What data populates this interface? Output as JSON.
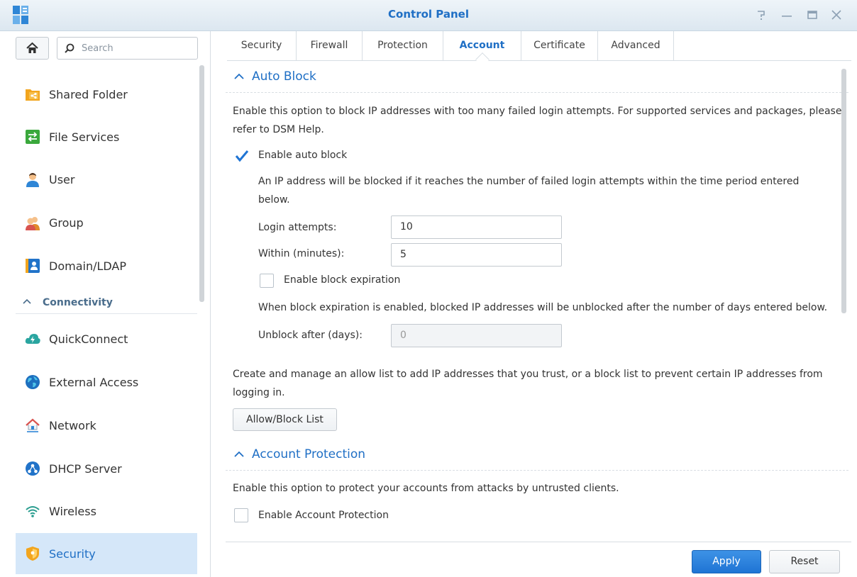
{
  "window": {
    "title": "Control Panel",
    "icon": "control-panel-icon",
    "controls": [
      "help-icon",
      "minimize-icon",
      "maximize-icon",
      "close-icon"
    ]
  },
  "sidebar": {
    "search_placeholder": "Search",
    "items": [
      {
        "label": "Shared Folder",
        "icon": "shared-folder-icon"
      },
      {
        "label": "File Services",
        "icon": "file-services-icon"
      },
      {
        "label": "User",
        "icon": "user-icon"
      },
      {
        "label": "Group",
        "icon": "group-icon"
      },
      {
        "label": "Domain/LDAP",
        "icon": "domain-ldap-icon"
      }
    ],
    "connectivity_header": "Connectivity",
    "connectivity_items": [
      {
        "label": "QuickConnect",
        "icon": "quickconnect-icon"
      },
      {
        "label": "External Access",
        "icon": "external-access-icon"
      },
      {
        "label": "Network",
        "icon": "network-icon"
      },
      {
        "label": "DHCP Server",
        "icon": "dhcp-server-icon"
      },
      {
        "label": "Wireless",
        "icon": "wireless-icon"
      },
      {
        "label": "Security",
        "icon": "security-icon",
        "active": true
      }
    ]
  },
  "tabs": [
    "Security",
    "Firewall",
    "Protection",
    "Account",
    "Certificate",
    "Advanced"
  ],
  "active_tab": "Account",
  "auto_block": {
    "title": "Auto Block",
    "description": "Enable this option to block IP addresses with too many failed login attempts. For supported services and packages, please refer to DSM Help.",
    "enable_label": "Enable auto block",
    "enable_checked": true,
    "threshold_note": "An IP address will be blocked if it reaches the number of failed login attempts within the time period entered below.",
    "login_attempts_label": "Login attempts:",
    "login_attempts_value": "10",
    "within_label": "Within (minutes):",
    "within_value": "5",
    "expiration_label": "Enable block expiration",
    "expiration_checked": false,
    "expiration_note": "When block expiration is enabled, blocked IP addresses will be unblocked after the number of days entered below.",
    "unblock_label": "Unblock after (days):",
    "unblock_value": "0",
    "allow_block_note": "Create and manage an allow list to add IP addresses that you trust, or a block list to prevent certain IP addresses from logging in.",
    "allow_block_button": "Allow/Block List"
  },
  "account_protection": {
    "title": "Account Protection",
    "description": "Enable this option to protect your accounts from attacks by untrusted clients.",
    "enable_label": "Enable Account Protection",
    "enable_checked": false
  },
  "footer": {
    "apply": "Apply",
    "reset": "Reset"
  },
  "colors": {
    "accent": "#1f6fc5",
    "apply_button": "#2a80dc",
    "active_nav_bg": "#d5e7f9"
  }
}
